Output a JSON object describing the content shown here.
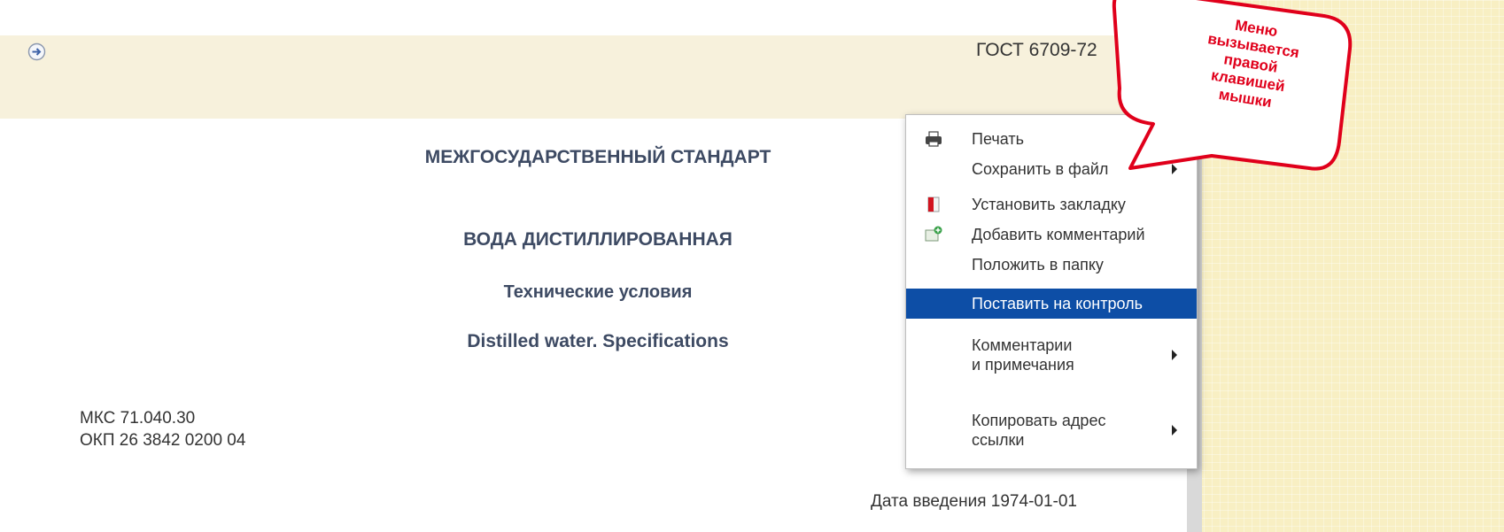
{
  "document": {
    "standard_id": "ГОСТ 6709-72",
    "category": "МЕЖГОСУДАРСТВЕННЫЙ СТАНДАРТ",
    "title_ru": "ВОДА ДИСТИЛЛИРОВАННАЯ",
    "subtitle_ru": "Технические условия",
    "title_en": "Distilled water. Specifications",
    "codes": [
      "МКС 71.040.30",
      "ОКП 26 3842 0200 04"
    ],
    "intro_date": "Дата введения 1974-01-01"
  },
  "nav": {
    "icon": "arrow-right-circle-icon"
  },
  "context_menu": {
    "items": [
      {
        "label": "Печать",
        "icon": "printer-icon",
        "submenu": false,
        "active": false
      },
      {
        "label": "Сохранить в файл",
        "icon": "",
        "submenu": true,
        "active": false
      },
      {
        "label": "Установить закладку",
        "icon": "bookmark-icon",
        "submenu": false,
        "active": false
      },
      {
        "label": "Добавить комментарий",
        "icon": "add-comment-icon",
        "submenu": false,
        "active": false
      },
      {
        "label": "Положить в папку",
        "icon": "",
        "submenu": false,
        "active": false
      },
      {
        "label": "Поставить на контроль",
        "icon": "",
        "submenu": false,
        "active": true
      },
      {
        "label_line1": "Комментарии",
        "label_line2": "и примечания",
        "icon": "",
        "submenu": true,
        "active": false
      },
      {
        "label_line1": "Копировать адрес",
        "label_line2": "ссылки",
        "icon": "",
        "submenu": true,
        "active": false
      }
    ]
  },
  "callout": {
    "lines": [
      "Меню",
      "вызывается",
      "правой",
      "клавишей",
      "мышки"
    ],
    "color": "#e0001b"
  },
  "colors": {
    "highlight": "#0d4ea6",
    "heading": "#3d4a63",
    "background": "#f8efc3"
  }
}
